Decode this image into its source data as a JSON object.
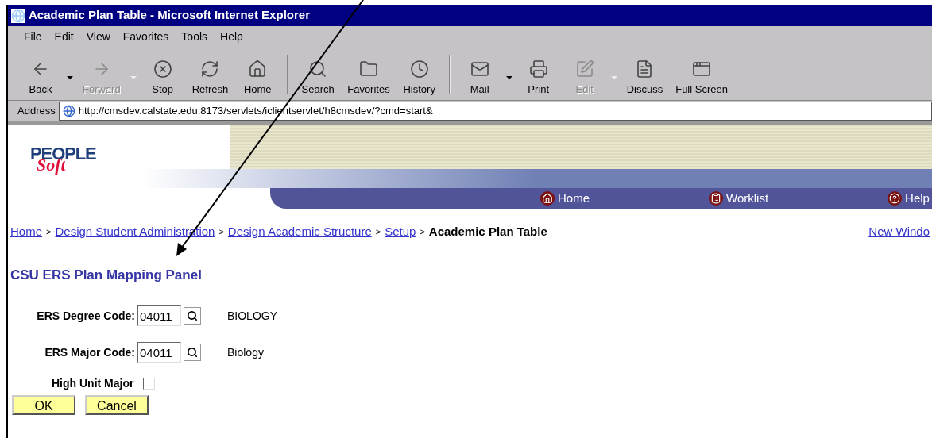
{
  "window": {
    "title": "Academic Plan Table - Microsoft Internet Explorer"
  },
  "menu": [
    "File",
    "Edit",
    "View",
    "Favorites",
    "Tools",
    "Help"
  ],
  "toolbar": [
    {
      "label": "Back",
      "kind": "back",
      "disabled": false,
      "dropdown": true,
      "separator_after": false
    },
    {
      "label": "Forward",
      "kind": "forward",
      "disabled": true,
      "dropdown": true,
      "separator_after": false
    },
    {
      "label": "Stop",
      "kind": "stop",
      "disabled": false,
      "dropdown": false,
      "separator_after": false
    },
    {
      "label": "Refresh",
      "kind": "refresh",
      "disabled": false,
      "dropdown": false,
      "separator_after": false
    },
    {
      "label": "Home",
      "kind": "home",
      "disabled": false,
      "dropdown": false,
      "separator_after": true
    },
    {
      "label": "Search",
      "kind": "search",
      "disabled": false,
      "dropdown": false,
      "separator_after": false
    },
    {
      "label": "Favorites",
      "kind": "favorites",
      "disabled": false,
      "dropdown": false,
      "separator_after": false
    },
    {
      "label": "History",
      "kind": "history",
      "disabled": false,
      "dropdown": false,
      "separator_after": true
    },
    {
      "label": "Mail",
      "kind": "mail",
      "disabled": false,
      "dropdown": true,
      "separator_after": false
    },
    {
      "label": "Print",
      "kind": "print",
      "disabled": false,
      "dropdown": false,
      "separator_after": false
    },
    {
      "label": "Edit",
      "kind": "edit",
      "disabled": true,
      "dropdown": true,
      "separator_after": false
    },
    {
      "label": "Discuss",
      "kind": "discuss",
      "disabled": false,
      "dropdown": false,
      "separator_after": false
    },
    {
      "label": "Full Screen",
      "kind": "fullscreen",
      "disabled": false,
      "dropdown": false,
      "separator_after": false
    }
  ],
  "address": {
    "label": "Address",
    "value": "http://cmsdev.calstate.edu:8173/servlets/iclientservlet/h8cmsdev/?cmd=start&"
  },
  "logo": {
    "top": "PEOPLE",
    "bottom": "Soft"
  },
  "nav": [
    {
      "label": "Home",
      "kind": "home"
    },
    {
      "label": "Worklist",
      "kind": "worklist"
    },
    {
      "label": "Help",
      "kind": "help"
    }
  ],
  "breadcrumb": [
    {
      "label": "Home",
      "link": true
    },
    {
      "label": "Design Student Administration",
      "link": true
    },
    {
      "label": "Design Academic Structure",
      "link": true
    },
    {
      "label": "Setup",
      "link": true
    },
    {
      "label": "Academic Plan Table",
      "link": false
    }
  ],
  "breadcrumb_separator": ">",
  "new_window": "New Windo",
  "panel_title": "CSU ERS Plan Mapping Panel",
  "fields": [
    {
      "label": "ERS Degree Code:",
      "value": "04011",
      "description": "BIOLOGY"
    },
    {
      "label": "ERS Major Code:",
      "value": "04011",
      "description": "Biology"
    }
  ],
  "high_unit_major": {
    "label": "High Unit Major",
    "checked": false
  },
  "buttons": [
    "OK",
    "Cancel"
  ]
}
